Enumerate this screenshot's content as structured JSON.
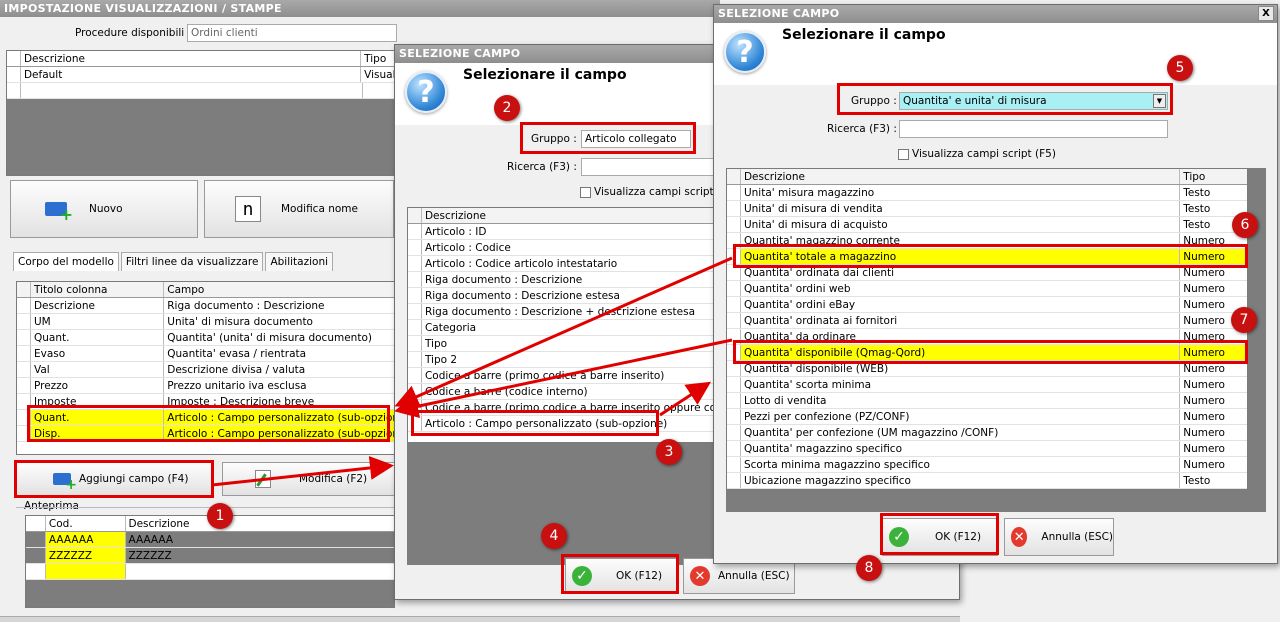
{
  "main": {
    "title": "IMPOSTAZIONE VISUALIZZAZIONI / STAMPE",
    "procedure_label": "Procedure disponibili :",
    "procedure_value": "Ordini clienti",
    "top_grid": {
      "col_desc": "Descrizione",
      "col_tipo": "Tipo",
      "row_desc": "Default",
      "row_tipo": "Visuali"
    },
    "btn_nuovo": "Nuovo",
    "btn_modifica_nome": "Modifica nome",
    "tabs": [
      "Corpo del modello",
      "Filtri linee da visualizzare",
      "Abilitazioni"
    ],
    "columns_grid": {
      "headers": [
        "Titolo colonna",
        "Campo"
      ],
      "rows": [
        [
          "Descrizione",
          "Riga documento : Descrizione"
        ],
        [
          "UM",
          "Unita' di misura documento"
        ],
        [
          "Quant.",
          "Quantita' (unita' di misura documento)"
        ],
        [
          "Evaso",
          "Quantita' evasa / rientrata"
        ],
        [
          "Val",
          "Descrizione divisa / valuta"
        ],
        [
          "Prezzo",
          "Prezzo unitario iva esclusa"
        ],
        [
          "Imposte",
          "Imposte : Descrizione breve"
        ],
        [
          "Quant.",
          "Articolo : Campo personalizzato (sub-opzione)"
        ],
        [
          "Disp.",
          "Articolo : Campo personalizzato (sub-opzione)"
        ]
      ]
    },
    "btn_aggiungi": "Aggiungi campo (F4)",
    "btn_modifica": "Modifica (F2)",
    "anteprima_label": "Anteprima",
    "preview": {
      "headers": [
        "Cod.",
        "Descrizione"
      ],
      "rows": [
        [
          "AAAAAA",
          "AAAAAA"
        ],
        [
          "ZZZZZZ",
          "ZZZZZZ"
        ]
      ]
    }
  },
  "dialog1": {
    "title": "SELEZIONE CAMPO",
    "heading": "Selezionare il campo",
    "gruppo_label": "Gruppo :",
    "gruppo_value": "Articolo collegato",
    "ricerca_label": "Ricerca (F3) :",
    "script_label": "Visualizza campi script (F",
    "col_desc": "Descrizione",
    "items": [
      "Articolo : ID",
      "Articolo : Codice",
      "Articolo : Codice articolo intestatario",
      "Riga documento : Descrizione",
      "Riga documento : Descrizione estesa",
      "Riga documento : Descrizione + descrizione estesa",
      "Categoria",
      "Tipo",
      "Tipo 2",
      "Codice a barre (primo codice a barre inserito)",
      "Codice a barre (codice interno)",
      "Codice a barre (primo codice a barre inserito oppure codice in",
      "Articolo : Campo personalizzato (sub-opzione)"
    ],
    "ok": "OK (F12)",
    "annulla": "Annulla (ESC)"
  },
  "dialog2": {
    "title": "SELEZIONE CAMPO",
    "heading": "Selezionare il campo",
    "gruppo_label": "Gruppo :",
    "gruppo_value": "Quantita' e unita' di misura",
    "ricerca_label": "Ricerca (F3) :",
    "script_label": "Visualizza campi script (F5)",
    "col_desc": "Descrizione",
    "col_tipo": "Tipo",
    "items": [
      [
        "Unita' misura magazzino",
        "Testo"
      ],
      [
        "Unita' di misura di vendita",
        "Testo"
      ],
      [
        "Unita' di misura di acquisto",
        "Testo"
      ],
      [
        "Quantita' magazzino corrente",
        "Numero"
      ],
      [
        "Quantita' totale a magazzino",
        "Numero"
      ],
      [
        "Quantita' ordinata dai clienti",
        "Numero"
      ],
      [
        "Quantita' ordini web",
        "Numero"
      ],
      [
        "Quantita' ordini eBay",
        "Numero"
      ],
      [
        "Quantita' ordinata ai fornitori",
        "Numero"
      ],
      [
        "Quantita' da ordinare",
        "Numero"
      ],
      [
        "Quantita' disponibile (Qmag-Qord)",
        "Numero"
      ],
      [
        "Quantita' disponibile (WEB)",
        "Numero"
      ],
      [
        "Quantita' scorta minima",
        "Numero"
      ],
      [
        "Lotto di vendita",
        "Numero"
      ],
      [
        "Pezzi per confezione (PZ/CONF)",
        "Numero"
      ],
      [
        "Quantita' per confezione (UM magazzino /CONF)",
        "Numero"
      ],
      [
        "Quantita' magazzino specifico",
        "Numero"
      ],
      [
        "Scorta minima magazzino specifico",
        "Numero"
      ],
      [
        "Ubicazione magazzino specifico",
        "Testo"
      ]
    ],
    "ok": "OK (F12)",
    "annulla": "Annulla (ESC)",
    "close": "X"
  },
  "badges": [
    "1",
    "2",
    "3",
    "4",
    "5",
    "6",
    "7",
    "8"
  ]
}
